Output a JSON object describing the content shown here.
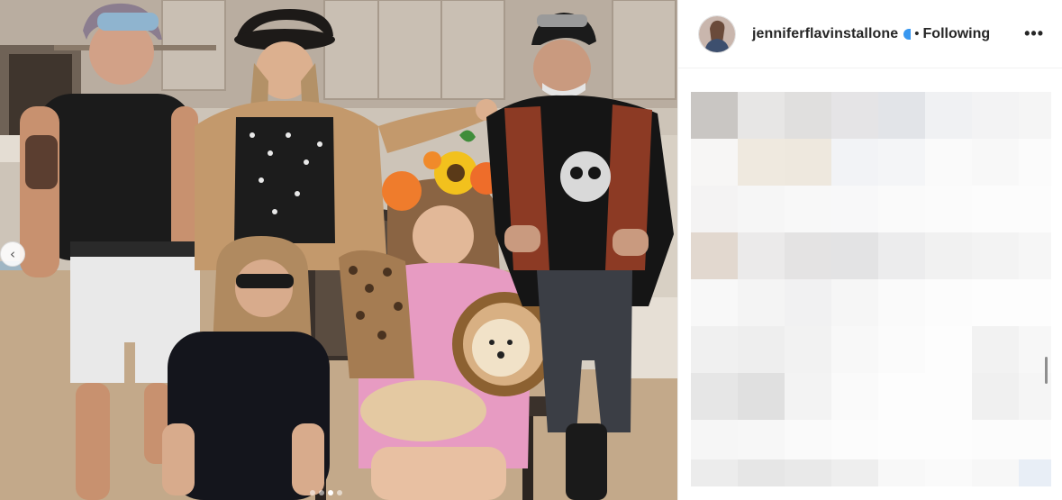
{
  "post": {
    "author": {
      "username": "jenniferflavinstallone",
      "verified": true
    },
    "separator": "•",
    "follow_state": "Following",
    "more_label": "•••"
  },
  "carousel": {
    "prev_label": "‹",
    "dots": 4,
    "active_dot": 2
  },
  "colors": {
    "verified_badge": "#3897f0",
    "text": "#262626"
  },
  "icons": {
    "more": "more-options-icon",
    "prev": "chevron-left-icon",
    "verified": "verified-badge-icon"
  }
}
